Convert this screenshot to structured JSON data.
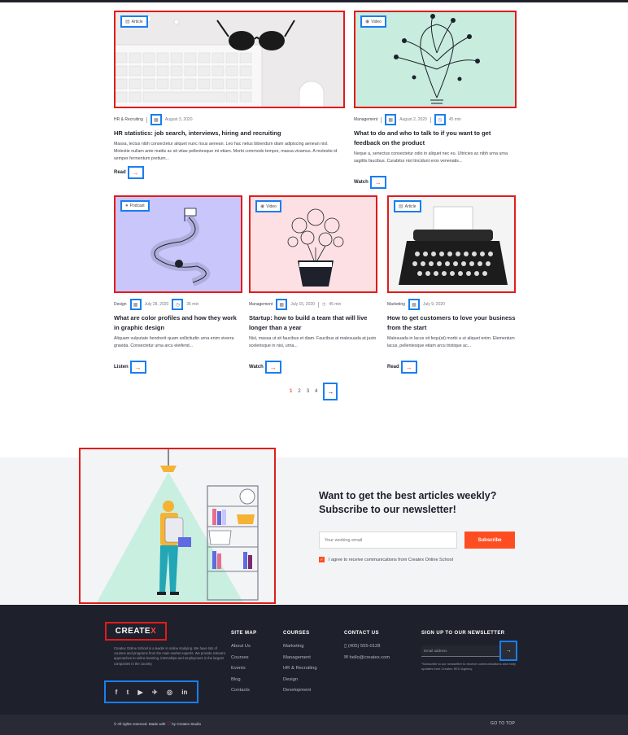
{
  "posts": [
    {
      "tag": "Article",
      "tag_icon": "file-icon",
      "category": "HR & Recruiting",
      "date": "August 3, 2020",
      "duration": "",
      "title": "HR statistics: job search,  interviews, hiring and recruiting",
      "excerpt": "Massa, lectus nibh consectetur aliquet nunc risus aenean. Leo hac netus bibendum diam adipiscing aenean nisl. Molestie nullam ante mattis ac sit vitae pellentesque mi etiam. Morbi commodo tempor, massa vivamus. A molestie id semper fermentum pretium...",
      "cta": "Read"
    },
    {
      "tag": "Video",
      "tag_icon": "play-icon",
      "category": "Management",
      "date": "August 2, 2020",
      "duration": "45 min",
      "title": "What to do and who to talk to if you want to get feedback on the product",
      "excerpt": "Neque a, senectus consectetur odio in aliquet nec eu. Ultricies ac nibh urna urna sagittis faucibus. Curabitur nisl tincidunt eros venenatis...",
      "cta": "Watch"
    },
    {
      "tag": "Podcast",
      "tag_icon": "mic-icon",
      "category": "Design",
      "date": "July 28, 2020",
      "duration": "36 min",
      "title": "What are color profiles and how they work in graphic design",
      "excerpt": "Aliquam vulputate hendrerit quam sollicitudin urna enim viverra gravida. Consectetur urna arcu eleifend...",
      "cta": "Listen"
    },
    {
      "tag": "Video",
      "tag_icon": "play-icon",
      "category": "Management",
      "date": "July 15, 2020",
      "duration": "45 min",
      "title": "Startup: how to build a team that will live longer than a year",
      "excerpt": "Nisl, massa ut sit faucibus et diam. Faucibus at malesuada at justo scelerisque in nisi, urna...",
      "cta": "Watch"
    },
    {
      "tag": "Article",
      "tag_icon": "file-icon",
      "category": "Marketing",
      "date": "July 9, 2020",
      "duration": "",
      "title": "How to get customers to love your business from the start",
      "excerpt": "Malesuada in lacus sit fequ(at) morbi a ut aliquet enim. Elementum lacus, pellentesque etiam arcu tristique ac...",
      "cta": "Read"
    }
  ],
  "pagination": {
    "pages": [
      "1",
      "2",
      "3",
      "4"
    ],
    "current": "1",
    "next_icon": "arrow-right-icon"
  },
  "subscribe": {
    "title": "Want to get the best articles weekly? Subscribe to our newsletter!",
    "placeholder": "Your working email",
    "button": "Subscribe",
    "agree": "I agree to receive communications from Createx Online School"
  },
  "footer": {
    "logo_main": "CREATE",
    "logo_x": "X",
    "about": "Createx Online School is a leader in online studying. We have lots of courses and programs from the main market experts. We provide relevant approaches to online learning, internships and employment in the largest companies in the country.",
    "socials": [
      "f",
      "t",
      "▶",
      "✈",
      "◎",
      "in"
    ],
    "sitemap": {
      "title": "SITE MAP",
      "links": [
        "About Us",
        "Courses",
        "Events",
        "Blog",
        "Contacts"
      ]
    },
    "courses": {
      "title": "COURSES",
      "links": [
        "Marketing",
        "Management",
        "HR & Recruiting",
        "Design",
        "Development"
      ]
    },
    "contact": {
      "title": "CONTACT US",
      "phone": "(405) 555-0128",
      "email": "hello@createx.com"
    },
    "newsletter": {
      "title": "SIGN UP TO OUR NEWSLETTER",
      "placeholder": "Email address",
      "note": "*Subscribe to our newsletter to receive communications and early updates from Createx SEO Agency."
    },
    "copyright_pre": "© All rights reserved. Made with",
    "copyright_post": "by Createx Studio",
    "go_top": "GO TO TOP"
  },
  "colors": {
    "accent": "#ff4242",
    "dark": "#1e212c",
    "highlight_red": "#e21b1b",
    "highlight_blue": "#1a7ef0"
  }
}
